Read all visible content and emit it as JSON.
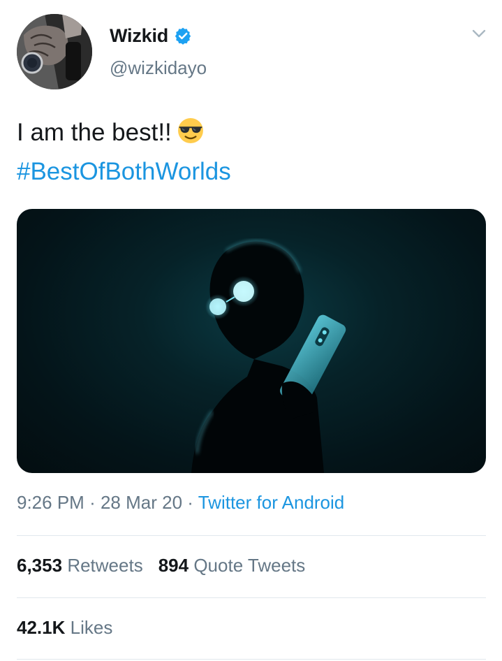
{
  "author": {
    "display_name": "Wizkid",
    "handle": "@wizkidayo",
    "verified": true
  },
  "tweet": {
    "text_line1": "I am the best!!",
    "emoji": "smiling-face-with-sunglasses",
    "hashtag": "#BestOfBothWorlds"
  },
  "meta": {
    "time": "9:26 PM",
    "separator": "·",
    "date": "28 Mar 20",
    "source": "Twitter for Android"
  },
  "stats": {
    "retweets_count": "6,353",
    "retweets_label": "Retweets",
    "quotes_count": "894",
    "quotes_label": "Quote Tweets",
    "likes_count": "42.1K",
    "likes_label": "Likes"
  },
  "colors": {
    "link": "#1b95e0",
    "secondary_text": "#657786",
    "primary_text": "#14171a",
    "divider": "#e1e8ed",
    "media_glow": "#5fd9ec"
  },
  "icons": [
    "verified-badge-icon",
    "chevron-down-icon",
    "sunglasses-emoji-icon"
  ]
}
